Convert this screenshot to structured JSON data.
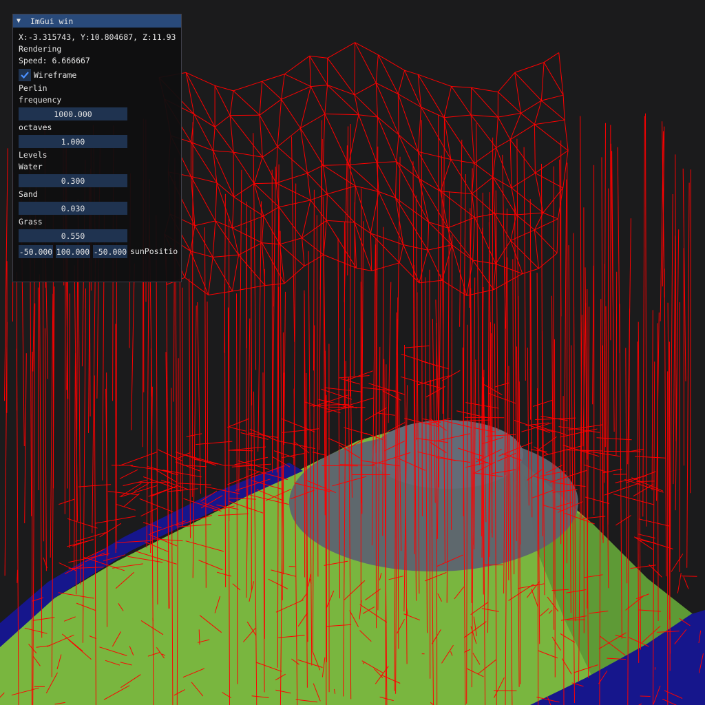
{
  "window": {
    "title": "ImGui win",
    "coords": "X:-3.315743, Y:10.804687, Z:11.93",
    "rendering_label": "Rendering",
    "speed": "Speed: 6.666667",
    "wireframe": {
      "label": "Wireframe",
      "checked": true
    }
  },
  "perlin": {
    "heading": "Perlin",
    "frequency": {
      "label": "frequency",
      "value": "1000.000"
    },
    "octaves": {
      "label": "octaves",
      "value": "1.000"
    }
  },
  "levels": {
    "heading": "Levels",
    "water": {
      "label": "Water",
      "value": "0.300"
    },
    "sand": {
      "label": "Sand",
      "value": "0.030"
    },
    "grass": {
      "label": "Grass",
      "value": "0.550"
    }
  },
  "sun": {
    "label": "sunPositio",
    "x": "-50.000",
    "y": "100.000",
    "z": "-50.000"
  },
  "colors": {
    "background": "#1b1b1c",
    "wire": "#ff0000",
    "grass": "#79b63f",
    "water": "#16168c",
    "rock": "#5d6470",
    "title_bar": "#294a7a",
    "slider": "#1f3350",
    "check_accent": "#4a90ff"
  }
}
